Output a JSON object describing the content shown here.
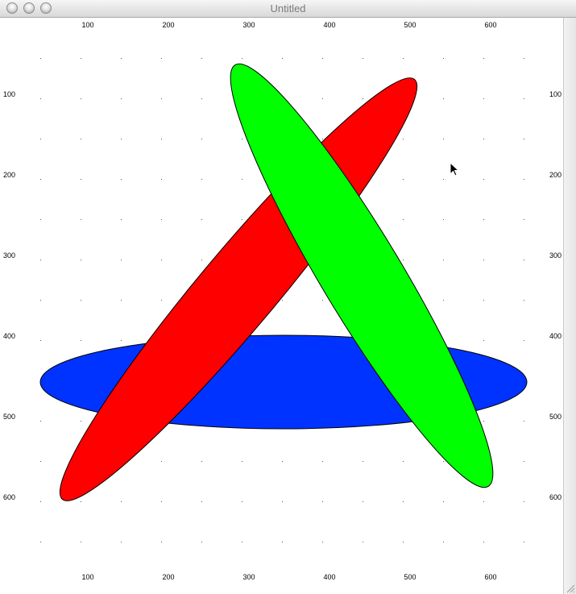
{
  "window": {
    "title": "Untitled"
  },
  "ruler": {
    "x_ticks": [
      "100",
      "200",
      "300",
      "400",
      "500",
      "600"
    ],
    "y_ticks": [
      "100",
      "200",
      "300",
      "400",
      "500",
      "600"
    ]
  },
  "shapes": [
    {
      "name": "blue-ellipse",
      "color": "#0033ff"
    },
    {
      "name": "red-ellipse",
      "color": "#ff0000"
    },
    {
      "name": "green-ellipse",
      "color": "#00ff00"
    }
  ],
  "colors": {
    "outline": "#000000",
    "grid_dot": "#555555"
  }
}
